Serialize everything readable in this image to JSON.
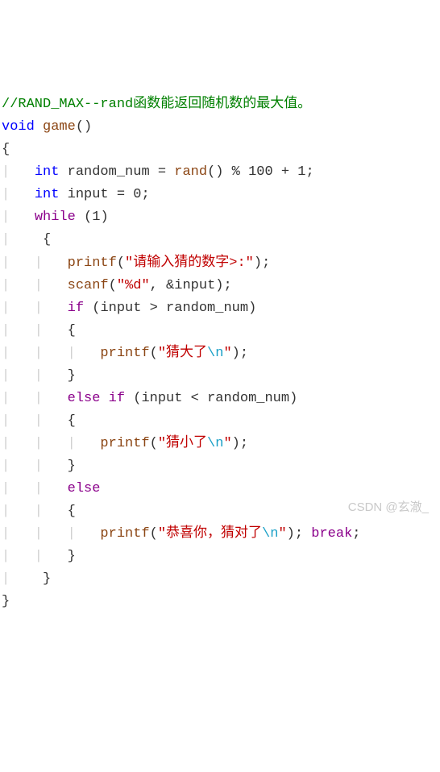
{
  "code": {
    "comment": "//RAND_MAX--rand函数能返回随机数的最大值。",
    "kw_void": "void",
    "fn_game": "game",
    "paren_open": "(",
    "paren_close": ")",
    "brace_open": "{",
    "brace_close": "}",
    "kw_int": "int",
    "var_random_num": "random_num",
    "eq": " = ",
    "fn_rand": "rand",
    "expr_mod": " % 100 + 1;",
    "var_input": "input",
    "expr_zero": " = 0;",
    "kw_while": "while",
    "one": "1",
    "fn_printf": "printf",
    "fn_scanf": "scanf",
    "str_prompt": "\"请输入猜的数字>:\"",
    "str_fmt": "\"%d\"",
    "arg_input": ", &input",
    "semi": ";",
    "kw_if": "if",
    "cond_gt": "input > random_num",
    "str_big_a": "\"猜大了",
    "esc_n": "\\n",
    "str_q": "\"",
    "kw_else": "else",
    "cond_lt": "input < random_num",
    "str_small_a": "\"猜小了",
    "str_win_a": "\"恭喜你，猜对了",
    "kw_break": "break"
  },
  "watermark": "CSDN @玄澈_"
}
